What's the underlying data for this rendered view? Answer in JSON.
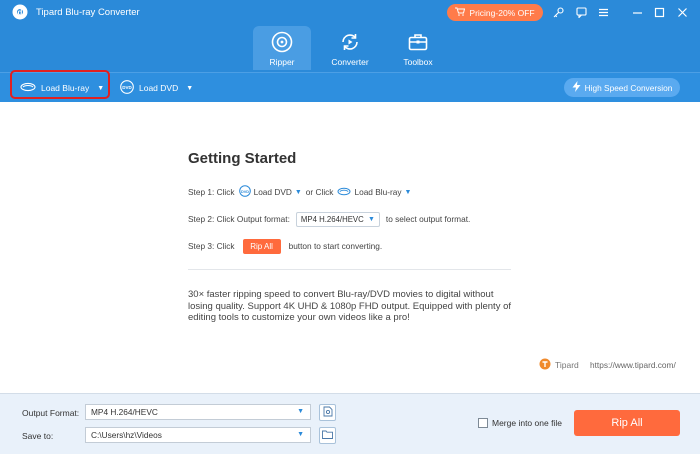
{
  "app": {
    "title": "Tipard Blu-ray Converter"
  },
  "pricing": {
    "label": "Pricing-20% OFF"
  },
  "nav": {
    "tabs": [
      {
        "label": "Ripper",
        "icon": "disc-icon",
        "active": true
      },
      {
        "label": "Converter",
        "icon": "convert-icon",
        "active": false
      },
      {
        "label": "Toolbox",
        "icon": "toolbox-icon",
        "active": false
      }
    ]
  },
  "toolbar": {
    "load_bluray": "Load Blu-ray",
    "load_dvd": "Load DVD",
    "high_speed": "High Speed Conversion"
  },
  "main": {
    "title": "Getting Started",
    "step1": {
      "prefix": "Step 1: Click",
      "dvd": "Load DVD",
      "or": "or Click",
      "bluray": "Load Blu-ray"
    },
    "step2": {
      "prefix": "Step 2: Click Output format:",
      "format": "MP4 H.264/HEVC",
      "suffix": "to select output format."
    },
    "step3": {
      "prefix": "Step 3: Click",
      "button": "Rip All",
      "suffix": "button to start converting."
    },
    "description": "30× faster ripping speed to convert  Blu-ray/DVD movies to digital without losing quality. Support 4K UHD & 1080p FHD output. Equipped with plenty of editing tools to customize your own videos like a pro!",
    "brand": "Tipard",
    "url": "https://www.tipard.com/"
  },
  "bottom": {
    "output_format_label": "Output Format:",
    "output_format_value": "MP4 H.264/HEVC",
    "save_to_label": "Save to:",
    "save_to_value": "C:\\Users\\hz\\Videos",
    "merge_label": "Merge into one file",
    "rip_all": "Rip All"
  },
  "colors": {
    "primary": "#2b8ad9",
    "accent": "#ff6a3d",
    "pricing": "#ff7b4a"
  }
}
